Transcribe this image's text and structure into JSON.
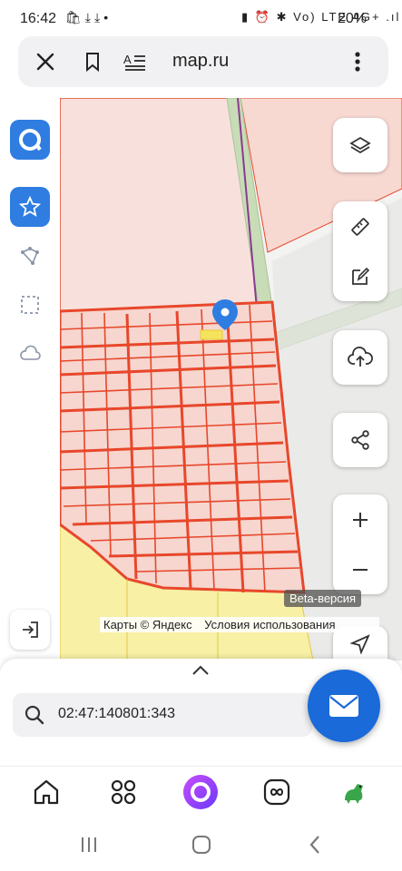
{
  "status_bar": {
    "time": "16:42",
    "left_icons": [
      "bag-icon",
      "download-icon",
      "download-icon",
      "dot-icon"
    ],
    "right_icons_text": "▮ ⏰ ✱ Vo) LTE 4G+ .ıl",
    "battery": "20%"
  },
  "browser": {
    "url": "map.ru",
    "close_icon": "close-icon",
    "bookmark_icon": "bookmark-icon",
    "reader_icon": "reader-mode-icon",
    "menu_icon": "more-vertical-icon"
  },
  "left_toolbar": {
    "items": [
      "logo-icon",
      "star-icon",
      "polygon-icon",
      "selection-icon",
      "cloud-icon",
      "login-icon"
    ],
    "active": "star-icon"
  },
  "right_controls": [
    "layers-icon",
    "ruler-icon",
    "edit-icon",
    "upload-icon",
    "share-icon",
    "zoom-in-icon",
    "zoom-out-icon",
    "locate-icon"
  ],
  "map": {
    "beta_label": "Beta-версия",
    "attribution": "Карты © Яндекс",
    "terms": "Условия использования",
    "parcel_color": "#e8472b",
    "marker_color": "#2f7de1"
  },
  "sheet": {
    "search_value": "02:47:140801:343"
  },
  "bottom_nav": [
    "home-icon",
    "apps-icon",
    "alice-icon",
    "infinity-icon",
    "dino-icon"
  ],
  "system_nav": [
    "recent-apps-icon",
    "home-circle-icon",
    "back-icon"
  ]
}
